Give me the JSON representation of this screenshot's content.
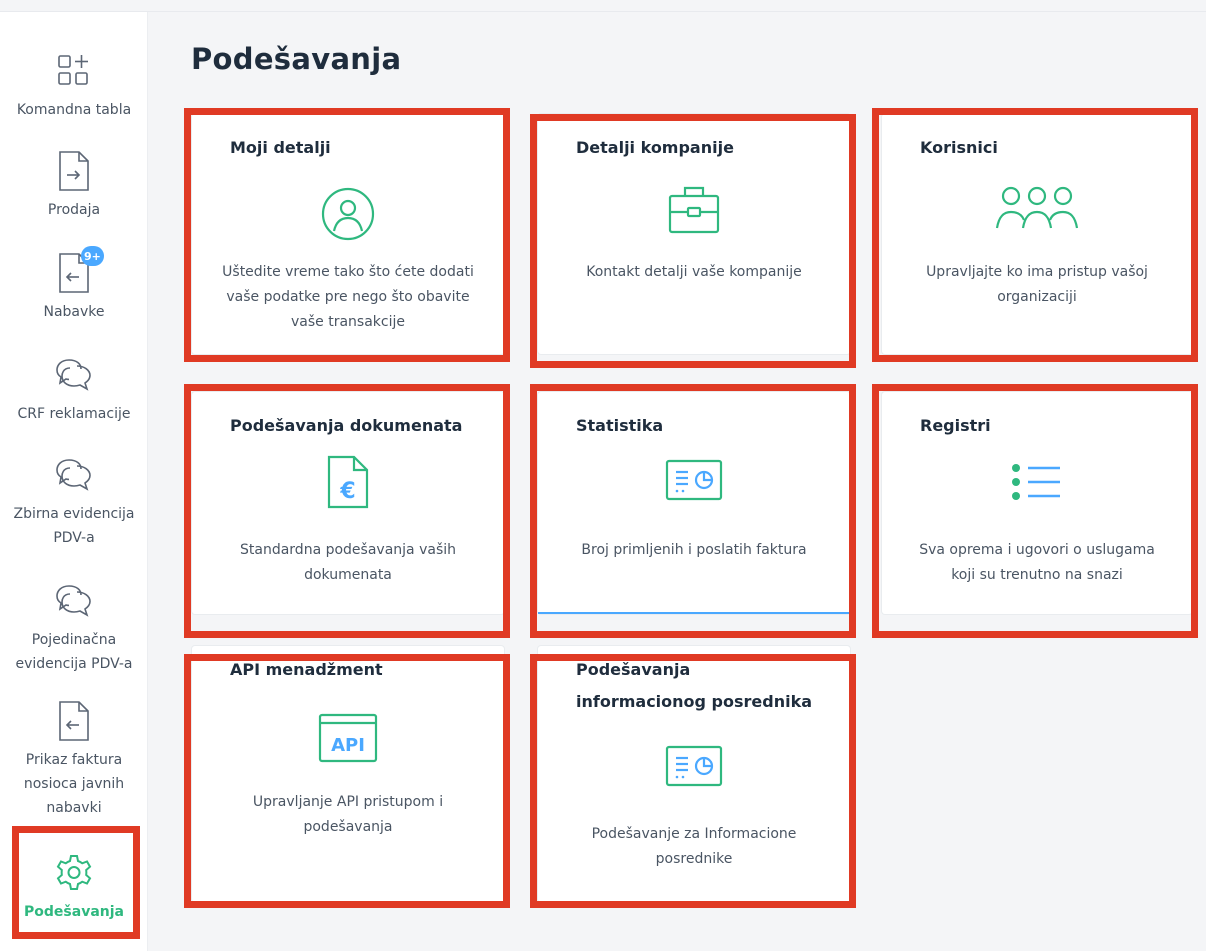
{
  "sidebar": {
    "items": [
      {
        "label": "Komandna tabla",
        "icon": "dashboard-add-icon"
      },
      {
        "label": "Prodaja",
        "icon": "document-out-icon"
      },
      {
        "label": "Nabavke",
        "icon": "document-in-icon",
        "badge": "9+"
      },
      {
        "label": "CRF reklamacije",
        "icon": "chat-bubbles-icon"
      },
      {
        "label": "Zbirna evidencija PDV-a",
        "icon": "chat-bubbles-icon"
      },
      {
        "label": "Pojedinačna evidencija PDV-a",
        "icon": "chat-bubbles-icon"
      },
      {
        "label": "Prikaz faktura nosioca javnih nabavki",
        "icon": "document-in-icon"
      },
      {
        "label": "Podešavanja",
        "icon": "gear-icon",
        "active": true
      }
    ]
  },
  "main": {
    "title": "Podešavanja",
    "cards": [
      {
        "title": "Moji detalji",
        "description": "Uštedite vreme tako što ćete dodati vaše podatke pre nego što obavite vaše transakcije",
        "icon": "user-circle-icon"
      },
      {
        "title": "Detalji kompanije",
        "description": "Kontakt detalji vaše kompanije",
        "icon": "briefcase-icon"
      },
      {
        "title": "Korisnici",
        "description": "Upravljajte ko ima pristup vašoj organizaciji",
        "icon": "users-group-icon"
      },
      {
        "title": "Podešavanja dokumenata",
        "description": "Standardna podešavanja vaših dokumenata",
        "icon": "euro-document-icon"
      },
      {
        "title": "Statistika",
        "description": "Broj primljenih i poslatih faktura",
        "icon": "statistics-icon"
      },
      {
        "title": "Registri",
        "description": "Sva oprema i ugovori o uslugama koji su trenutno na snazi",
        "icon": "list-icon"
      },
      {
        "title": "API menadžment",
        "description": "Upravljanje API pristupom i podešavanja",
        "icon": "api-icon",
        "icon_text": "API"
      },
      {
        "title": "Podešavanja informacionog posrednika",
        "description": "Podešavanje za Informacione posrednike",
        "icon": "statistics-icon"
      }
    ]
  },
  "colors": {
    "accent_green": "#2fb87f",
    "accent_blue": "#4aa8ff",
    "highlight_red": "#e03a24"
  }
}
